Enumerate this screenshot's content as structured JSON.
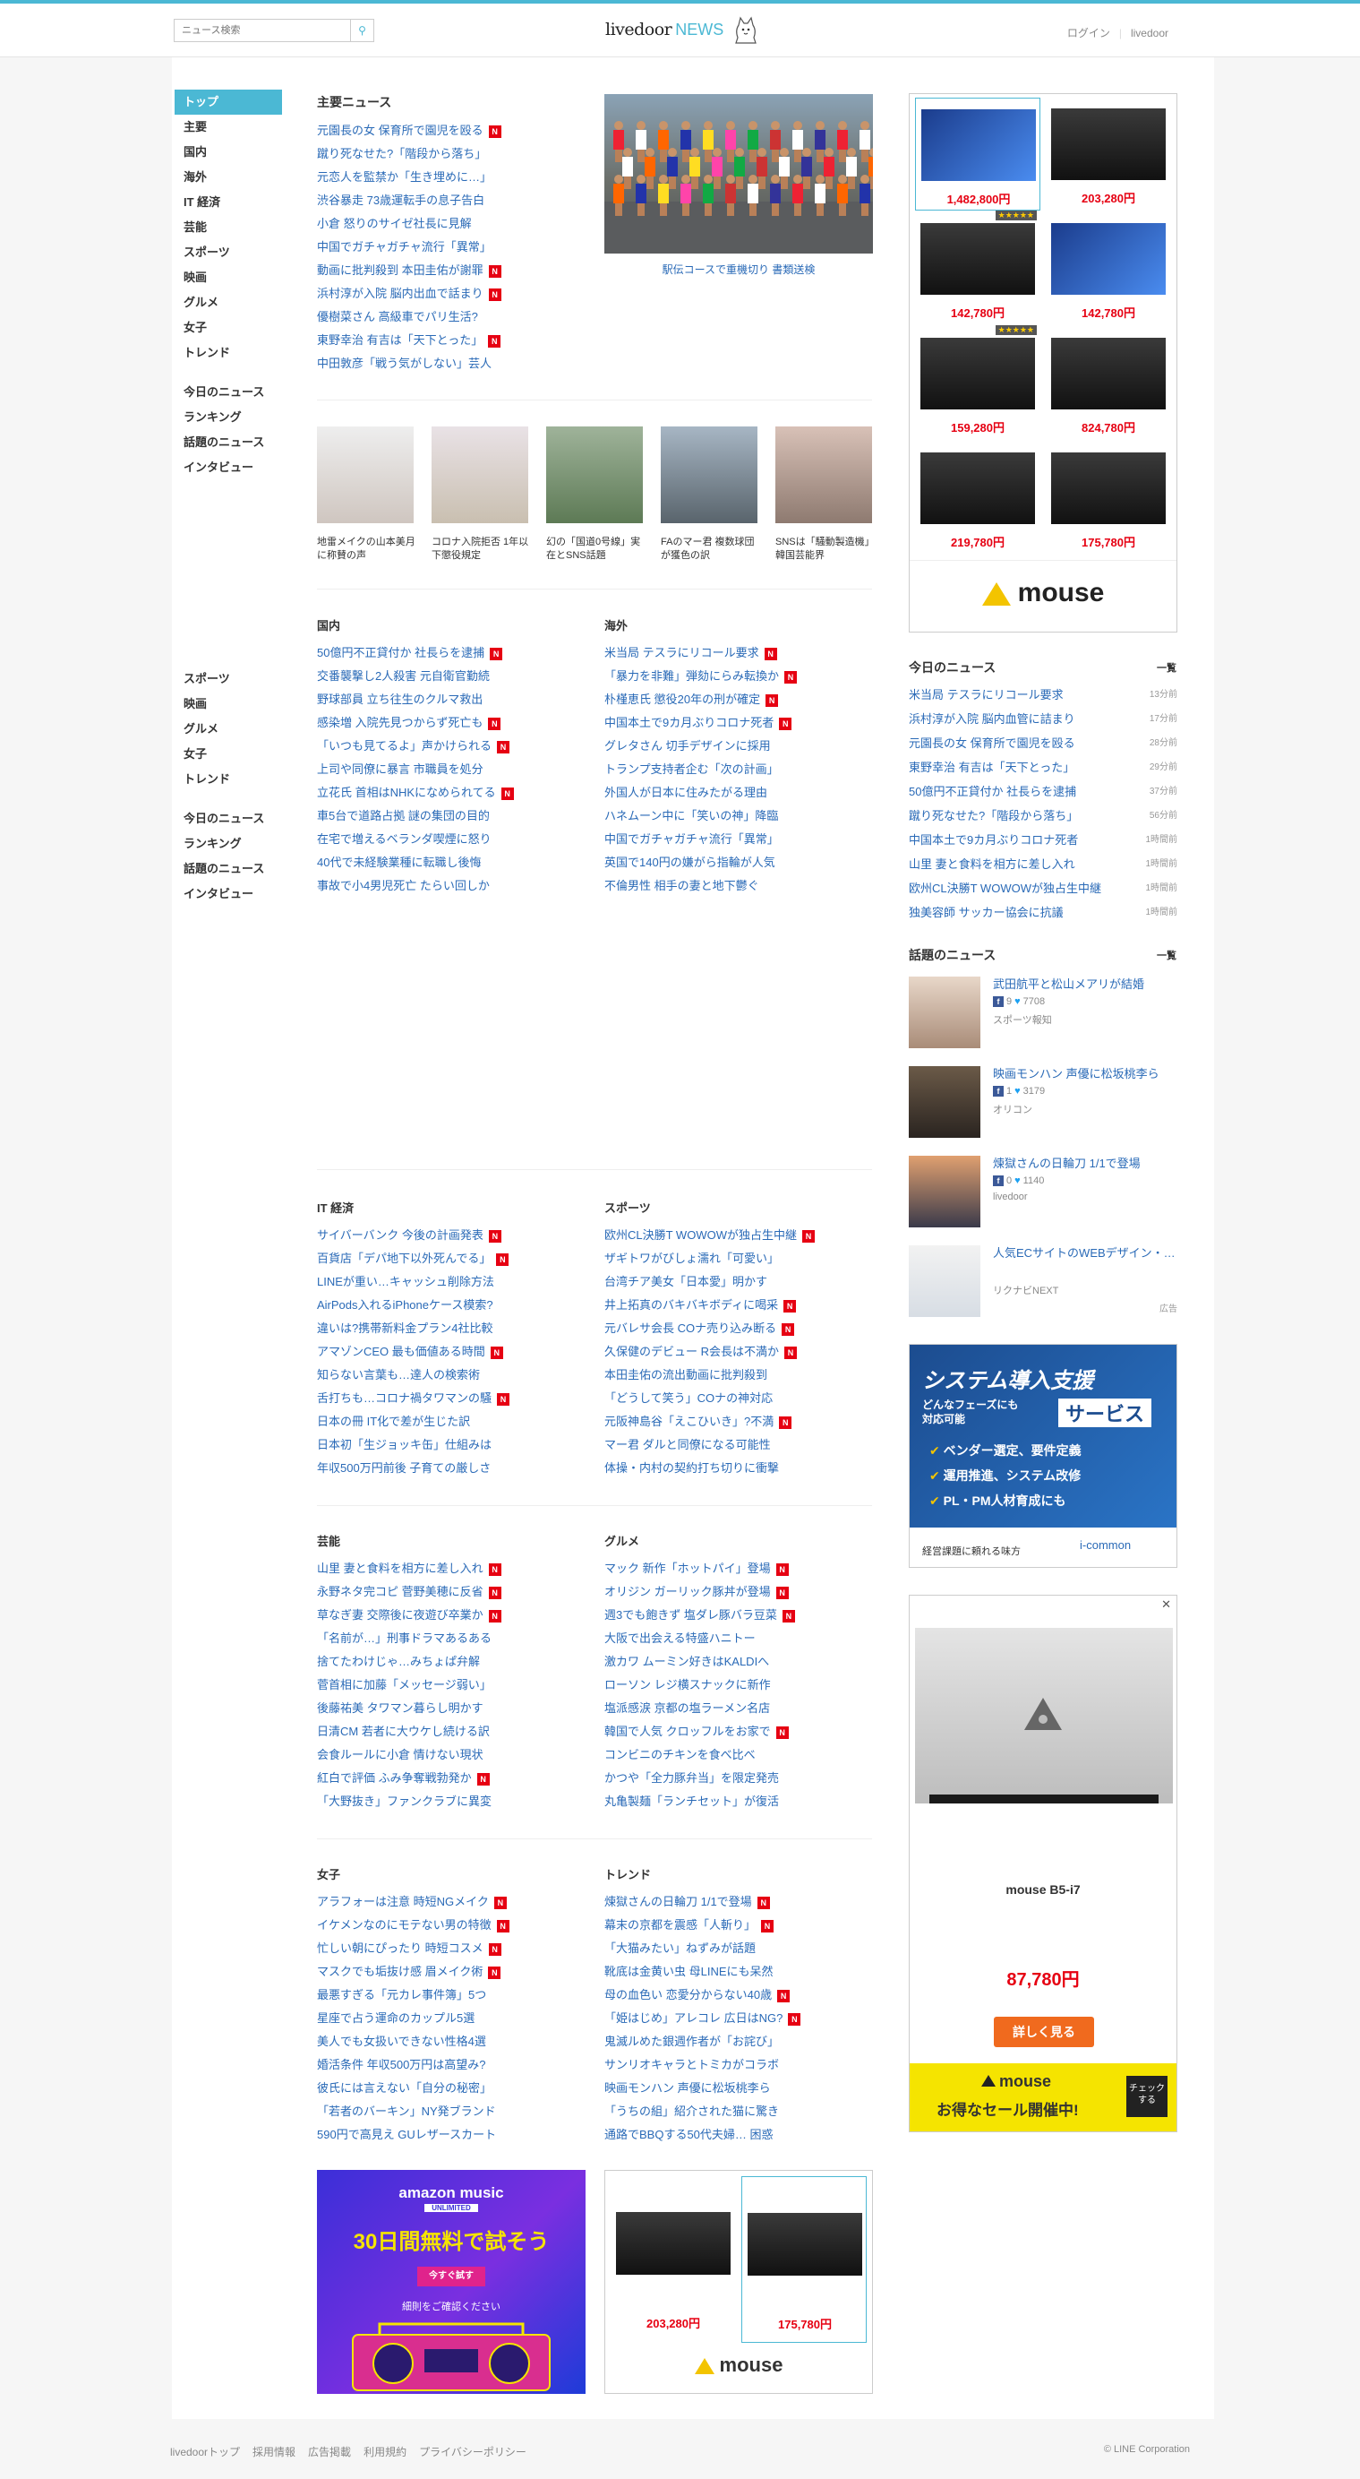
{
  "header": {
    "search_placeholder": "ニュース検索",
    "logo_main": "livedoor",
    "logo_news": "NEWS",
    "login": "ログイン",
    "livedoor_link": "livedoor"
  },
  "left_nav": {
    "items": [
      "トップ",
      "主要",
      "国内",
      "海外",
      "IT 経済",
      "芸能",
      "スポーツ",
      "映画",
      "グルメ",
      "女子",
      "トレンド"
    ],
    "items2": [
      "今日のニュース",
      "ランキング",
      "話題のニュース",
      "インタビュー"
    ],
    "sticky_items": [
      "スポーツ",
      "映画",
      "グルメ",
      "女子",
      "トレンド"
    ],
    "sticky_items2": [
      "今日のニュース",
      "ランキング",
      "話題のニュース",
      "インタビュー"
    ]
  },
  "main_news": {
    "title": "主要ニュース",
    "items": [
      {
        "text": "元園長の女 保育所で園児を殴る",
        "new": true
      },
      {
        "text": "蹴り死なせた?「階段から落ち」",
        "new": false
      },
      {
        "text": "元恋人を監禁か「生き埋めに…」",
        "new": false
      },
      {
        "text": "渋谷暴走 73歳運転手の息子告白",
        "new": false
      },
      {
        "text": "小倉 怒りのサイゼ社長に見解",
        "new": false
      },
      {
        "text": "中国でガチャガチャ流行「異常」",
        "new": false
      },
      {
        "text": "動画に批判殺到 本田圭佑が謝罪",
        "new": true
      },
      {
        "text": "浜村淳が入院 脳内出血で話まり",
        "new": true
      },
      {
        "text": "優樹菜さん 高級車でパリ生活?",
        "new": false
      },
      {
        "text": "東野幸治 有吉は「天下とった」",
        "new": true
      },
      {
        "text": "中田敦彦「戦う気がしない」芸人",
        "new": false
      }
    ],
    "feature_caption": "駅伝コースで重機切り 書類送検"
  },
  "thumbs": [
    {
      "caption": "地雷メイクの山本美月に称賛の声"
    },
    {
      "caption": "コロナ入院拒否 1年以下懲役規定"
    },
    {
      "caption": "幻の「国道0号線」実在とSNS話題"
    },
    {
      "caption": "FAのマー君 複数球団が獲色の訳"
    },
    {
      "caption": "SNSは「騒動製造機」韓国芸能界"
    }
  ],
  "domestic": {
    "title": "国内",
    "items": [
      {
        "text": "50億円不正貸付か 社長らを逮捕",
        "new": true
      },
      {
        "text": "交番襲撃し2人殺害 元自衛官勤続",
        "new": false
      },
      {
        "text": "野球部員 立ち往生のクルマ救出",
        "new": false
      },
      {
        "text": "感染増 入院先見つからず死亡も",
        "new": true
      },
      {
        "text": "「いつも見てるよ」声かけられる",
        "new": true
      },
      {
        "text": "上司や同僚に暴言 市職員を処分",
        "new": false
      },
      {
        "text": "立花氏 首相はNHKになめられてる",
        "new": true
      },
      {
        "text": "車5台で道路占拠 謎の集団の目的",
        "new": false
      },
      {
        "text": "在宅で増えるベランダ喫煙に怒り",
        "new": false
      },
      {
        "text": "40代で未経験業種に転職し後悔",
        "new": false
      },
      {
        "text": "事故で小4男児死亡 たらい回しか",
        "new": false
      }
    ]
  },
  "overseas": {
    "title": "海外",
    "items": [
      {
        "text": "米当局 テスラにリコール要求",
        "new": true
      },
      {
        "text": "「暴力を非難」弾劾にらみ転換か",
        "new": true
      },
      {
        "text": "朴槿恵氏 懲役20年の刑が確定",
        "new": true
      },
      {
        "text": "中国本土で9カ月ぶりコロナ死者",
        "new": true
      },
      {
        "text": "グレタさん 切手デザインに採用",
        "new": false
      },
      {
        "text": "トランプ支持者企む「次の計画」",
        "new": false
      },
      {
        "text": "外国人が日本に住みたがる理由",
        "new": false
      },
      {
        "text": "ハネムーン中に「笑いの神」降臨",
        "new": false
      },
      {
        "text": "中国でガチャガチャ流行「異常」",
        "new": false
      },
      {
        "text": "英国で140円の嫌がら指輪が人気",
        "new": false
      },
      {
        "text": "不倫男性 相手の妻と地下鬱ぐ",
        "new": false
      }
    ]
  },
  "it": {
    "title": "IT 経済",
    "items": [
      {
        "text": "サイバーバンク 今後の計画発表",
        "new": true
      },
      {
        "text": "百貨店「デパ地下以外死んでる」",
        "new": true
      },
      {
        "text": "LINEが重い…キャッシュ削除方法",
        "new": false
      },
      {
        "text": "AirPods入れるiPhoneケース模索?",
        "new": false
      },
      {
        "text": "違いは?携帯新料金プラン4社比較",
        "new": false
      },
      {
        "text": "アマゾンCEO 最も価値ある時間",
        "new": true
      },
      {
        "text": "知らない言葉も…達人の検索術",
        "new": false
      },
      {
        "text": "舌打ちも…コロナ禍タワマンの騒",
        "new": true
      },
      {
        "text": "日本の冊 IT化で差が生じた訳",
        "new": false
      },
      {
        "text": "日本初「生ジョッキ缶」仕組みは",
        "new": false
      },
      {
        "text": "年収500万円前後 子育ての厳しさ",
        "new": false
      }
    ]
  },
  "sports": {
    "title": "スポーツ",
    "items": [
      {
        "text": "欧州CL決勝T WOWOWが独占生中継",
        "new": true
      },
      {
        "text": "ザギトワがびしょ濡れ「可愛い」",
        "new": false
      },
      {
        "text": "台湾チア美女「日本愛」明かす",
        "new": false
      },
      {
        "text": "井上拓真のバキバキボディに喝采",
        "new": true
      },
      {
        "text": "元バレサ会長 COナ売り込み断る",
        "new": true
      },
      {
        "text": "久保健のデビュー R会長は不満か",
        "new": true
      },
      {
        "text": "本田圭佑の流出動画に批判殺到",
        "new": false
      },
      {
        "text": "「どうして笑う」COナの神対応",
        "new": false
      },
      {
        "text": "元阪神島谷「えこひいき」?不満",
        "new": true
      },
      {
        "text": "マー君 ダルと同僚になる可能性",
        "new": false
      },
      {
        "text": "体操・内村の契約打ち切りに衝撃",
        "new": false
      }
    ]
  },
  "geino": {
    "title": "芸能",
    "items": [
      {
        "text": "山里 妻と食料を相方に差し入れ",
        "new": true
      },
      {
        "text": "永野ネタ完コピ 菅野美穂に反省",
        "new": true
      },
      {
        "text": "草なぎ妻 交際後に夜遊び卒業か",
        "new": true
      },
      {
        "text": "「名前が…」刑事ドラマあるある",
        "new": false
      },
      {
        "text": "捨てたわけじゃ…みちょぱ弁解",
        "new": false
      },
      {
        "text": "菅首相に加藤「メッセージ弱い」",
        "new": false
      },
      {
        "text": "後藤祐美 タワマン暮らし明かす",
        "new": false
      },
      {
        "text": "日清CM 若者に大ウケし続ける訳",
        "new": false
      },
      {
        "text": "会食ルールに小倉 情けない現状",
        "new": false
      },
      {
        "text": "紅白で評価 ふみ争奪戦勃発か",
        "new": true
      },
      {
        "text": "「大野抜き」ファンクラブに異変",
        "new": false
      }
    ]
  },
  "gourmet": {
    "title": "グルメ",
    "items": [
      {
        "text": "マック 新作「ホットパイ」登場",
        "new": true
      },
      {
        "text": "オリジン ガーリック豚丼が登場",
        "new": true
      },
      {
        "text": "週3でも飽きず 塩ダレ豚バラ豆菜",
        "new": true
      },
      {
        "text": "大阪で出会える特盛ハニトー",
        "new": false
      },
      {
        "text": "激カワ ムーミン好きはKALDIへ",
        "new": false
      },
      {
        "text": "ローソン レジ横スナックに新作",
        "new": false
      },
      {
        "text": "塩派感涙 京都の塩ラーメン名店",
        "new": false
      },
      {
        "text": "韓国で人気 クロッフルをお家で",
        "new": true
      },
      {
        "text": "コンビニのチキンを食べ比べ",
        "new": false
      },
      {
        "text": "かつや「全力豚弁当」を限定発売",
        "new": false
      },
      {
        "text": "丸亀製麺「ランチセット」が復活",
        "new": false
      }
    ]
  },
  "joshi": {
    "title": "女子",
    "items": [
      {
        "text": "アラフォーは注意 時短NGメイク",
        "new": true
      },
      {
        "text": "イケメンなのにモテない男の特徴",
        "new": true
      },
      {
        "text": "忙しい朝にぴったり 時短コスメ",
        "new": true
      },
      {
        "text": "マスクでも垢抜け感 眉メイク術",
        "new": true
      },
      {
        "text": "最悪すぎる「元カレ事件簿」5つ",
        "new": false
      },
      {
        "text": "星座で占う運命のカップル5選",
        "new": false
      },
      {
        "text": "美人でも女扱いできない性格4選",
        "new": false
      },
      {
        "text": "婚活条件 年収500万円は高望み?",
        "new": false
      },
      {
        "text": "彼氏には言えない「自分の秘密」",
        "new": false
      },
      {
        "text": "「若者のバーキン」NY発ブランド",
        "new": false
      },
      {
        "text": "590円で高見え GUレザースカート",
        "new": false
      }
    ]
  },
  "trend": {
    "title": "トレンド",
    "items": [
      {
        "text": "煉獄さんの日輪刀 1/1で登場",
        "new": true
      },
      {
        "text": "幕末の京都を震感「人斬り」",
        "new": true
      },
      {
        "text": "「大猫みたい」ねずみが話題",
        "new": false
      },
      {
        "text": "靴底は金黄い虫 母LINEにも呆然",
        "new": false
      },
      {
        "text": "母の血色い 恋愛分からない40歳",
        "new": true
      },
      {
        "text": "「姫はじめ」アレコレ 広日はNG?",
        "new": true
      },
      {
        "text": "鬼滅ルめた銀週作者が「お詫び」",
        "new": false
      },
      {
        "text": "サンリオキャラとトミカがコラボ",
        "new": false
      },
      {
        "text": "映画モンハン 声優に松坂桃李ら",
        "new": false
      },
      {
        "text": "「うちの組」紹介された猫に驚き",
        "new": false
      },
      {
        "text": "通路でBBQする50代夫婦… 困惑",
        "new": false
      }
    ]
  },
  "pc_ad": {
    "prices": [
      "1,482,800円",
      "203,280円",
      "142,780円",
      "142,780円",
      "159,280円",
      "824,780円",
      "219,780円",
      "175,780円"
    ],
    "brand": "mouse",
    "stars": "★★★★★"
  },
  "today": {
    "title": "今日のニュース",
    "more": "一覧",
    "items": [
      {
        "text": "米当局 テスラにリコール要求",
        "time": "13分前"
      },
      {
        "text": "浜村淳が入院 脳内血管に詰まり",
        "time": "17分前"
      },
      {
        "text": "元園長の女 保育所で園児を殴る",
        "time": "28分前"
      },
      {
        "text": "東野幸治 有吉は「天下とった」",
        "time": "29分前"
      },
      {
        "text": "50億円不正貸付か 社長らを逮捕",
        "time": "37分前"
      },
      {
        "text": "蹴り死なせた?「階段から落ち」",
        "time": "56分前"
      },
      {
        "text": "中国本土で9カ月ぶりコロナ死者",
        "time": "1時間前"
      },
      {
        "text": "山里 妻と食料を相方に差し入れ",
        "time": "1時間前"
      },
      {
        "text": "欧州CL決勝T WOWOWが独占生中継",
        "time": "1時間前"
      },
      {
        "text": "独美容師 サッカー協会に抗議",
        "time": "1時間前"
      }
    ]
  },
  "topics": {
    "title": "話題のニュース",
    "more": "一覧",
    "items": [
      {
        "title": "武田航平と松山メアリが結婚",
        "fb": "9",
        "tw": "7708",
        "src": "スポーツ報知"
      },
      {
        "title": "映画モンハン 声優に松坂桃李ら",
        "fb": "1",
        "tw": "3179",
        "src": "オリコン"
      },
      {
        "title": "煉獄さんの日輪刀 1/1で登場",
        "fb": "0",
        "tw": "1140",
        "src": "livedoor"
      }
    ],
    "ad": {
      "title": "人気ECサイトのWEBデザイン・…",
      "src": "リクナビNEXT",
      "label": "広告"
    }
  },
  "system_ad": {
    "line1": "システム導入支援",
    "line2": "どんなフェーズにも",
    "line3": "対応可能",
    "line4": "サービス",
    "b1": "ベンダー選定、要件定義",
    "b2": "運用推進、システム改修",
    "b3": "PL・PM人材育成にも",
    "foot": "経営課題に頼れる味方",
    "brand": "i-common"
  },
  "mouse_ad": {
    "model": "mouse B5-i7",
    "price": "87,780円",
    "cta": "詳しく見る",
    "brand": "mouse",
    "sale": "お得なセール開催中!",
    "check": "チェックする"
  },
  "amazon_ad": {
    "brand": "amazon music",
    "sub": "UNLIMITED",
    "headline": "30日間無料で試そう",
    "cta": "今すぐ試す",
    "note": "細則をご確認ください"
  },
  "bottom_pc_ad": {
    "prices": [
      "203,280円",
      "175,780円"
    ],
    "brand": "mouse"
  },
  "footer": {
    "links": [
      "livedoorトップ",
      "採用情報",
      "広告掲載",
      "利用規約",
      "プライバシーポリシー"
    ],
    "copyright": "© LINE Corporation"
  }
}
